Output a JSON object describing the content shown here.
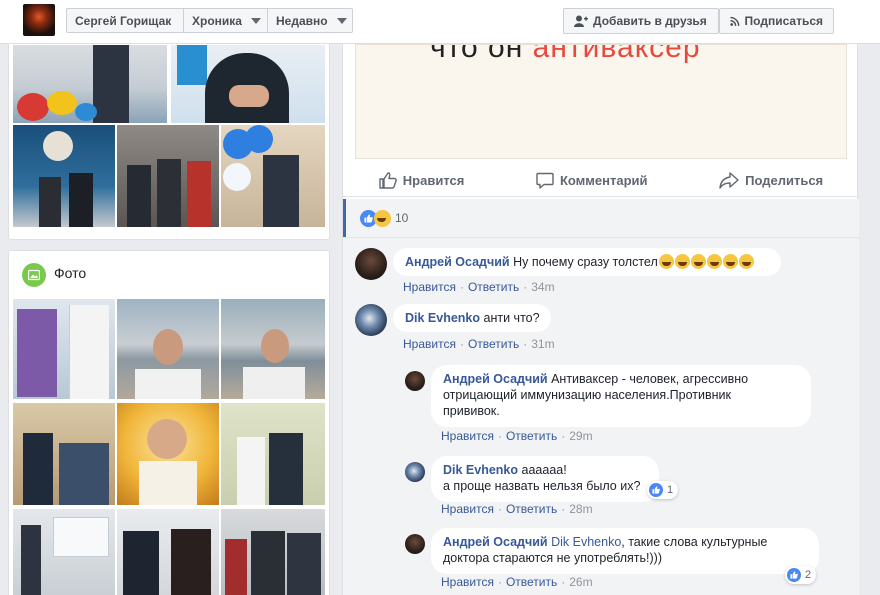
{
  "header": {
    "profile_name": "Сергей Горищак",
    "timeline_label": "Хроника",
    "recent_label": "Недавно",
    "add_friend_label": "Добавить в друзья",
    "subscribe_label": "Подписаться"
  },
  "photos_section": {
    "title": "Фото"
  },
  "post": {
    "image_text_prefix": "что он",
    "image_text_highlight": "антиваксер",
    "like_label": "Нравится",
    "comment_label": "Комментарий",
    "share_label": "Поделиться",
    "reaction_count": "10"
  },
  "comments": [
    {
      "author": "Андрей Осадчий",
      "text": "Ну почему сразу толстел",
      "like": "Нравится",
      "reply": "Ответить",
      "time": "34m"
    },
    {
      "author": "Dik Evhenko",
      "text": "анти что?",
      "like": "Нравится",
      "reply": "Ответить",
      "time": "31m"
    },
    {
      "author": "Андрей Осадчий",
      "text": "Антиваксер - человек, агрессивно",
      "text2": "отрицающий иммунизацию населения.Противник",
      "text3": "прививок.",
      "like": "Нравится",
      "reply": "Ответить",
      "time": "29m"
    },
    {
      "author": "Dik Evhenko",
      "text": "аааааа!",
      "text2": "а проще назвать нельзя было их?",
      "like": "Нравится",
      "reply": "Ответить",
      "time": "28m",
      "reactions": "1"
    },
    {
      "author": "Андрей Осадчий",
      "mention": "Dik Evhenko",
      "text": ", такие слова культурные",
      "text2": "доктора стараются не употреблять!)))",
      "like": "Нравится",
      "reply": "Ответить",
      "time": "26m",
      "reactions": "2"
    }
  ],
  "colors": {
    "link": "#385898",
    "accent": "#4267b2",
    "highlight_red": "#e8493f"
  }
}
